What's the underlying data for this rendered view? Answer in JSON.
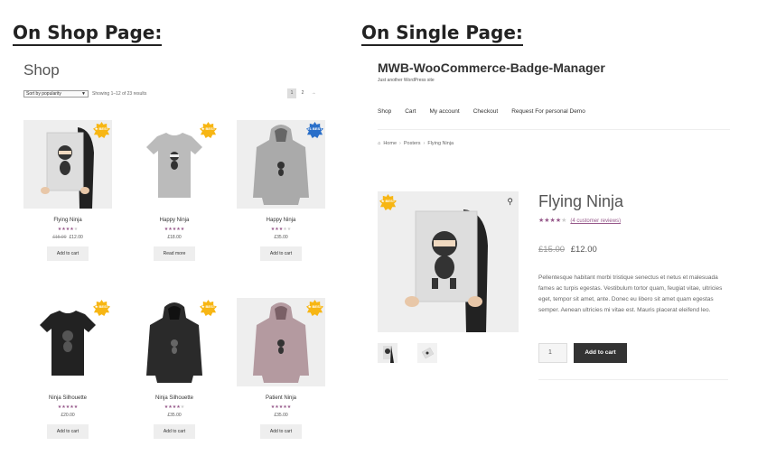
{
  "headings": {
    "shop": "On Shop Page:",
    "single": "On Single Page:"
  },
  "shop": {
    "title": "Shop",
    "sort": "Sort by popularity",
    "result_count": "Showing 1–12 of 23 results",
    "pages": [
      "1",
      "2",
      "→"
    ],
    "products": [
      {
        "name": "Flying Ninja",
        "old_price": "£15.00",
        "price": "£12.00",
        "rating": 4,
        "button": "Add to cart",
        "badge": "★ BEST",
        "badge_color": "#f7b614",
        "image": "poster"
      },
      {
        "name": "Happy Ninja",
        "old_price": "",
        "price": "£18.00",
        "rating": 5,
        "button": "Read more",
        "badge": "★ BEST",
        "badge_color": "#f7b614",
        "image": "tshirt-grey"
      },
      {
        "name": "Happy Ninja",
        "old_price": "",
        "price": "£35.00",
        "rating": 3,
        "button": "Add to cart",
        "badge": "#1 BEST",
        "badge_color": "#2a6fc9",
        "image": "hoodie-grey"
      },
      {
        "name": "Ninja Silhouette",
        "old_price": "",
        "price": "£20.00",
        "rating": 5,
        "button": "Add to cart",
        "badge": "★ BEST",
        "badge_color": "#f7b614",
        "image": "tshirt-black"
      },
      {
        "name": "Ninja Silhouette",
        "old_price": "",
        "price": "£35.00",
        "rating": 4,
        "button": "Add to cart",
        "badge": "★ BEST",
        "badge_color": "#f7b614",
        "image": "hoodie-black"
      },
      {
        "name": "Patient Ninja",
        "old_price": "",
        "price": "£35.00",
        "rating": 5,
        "button": "Add to cart",
        "badge": "★ BEST",
        "badge_color": "#f7b614",
        "image": "hoodie-pink"
      }
    ]
  },
  "single": {
    "site_title": "MWB-WooCommerce-Badge-Manager",
    "tagline": "Just another WordPress site",
    "nav": [
      "Shop",
      "Cart",
      "My account",
      "Checkout",
      "Request For personal Demo"
    ],
    "breadcrumb": {
      "home": "Home",
      "category": "Posters",
      "current": "Flying Ninja"
    },
    "product_title": "Flying Ninja",
    "rating": 4,
    "reviews": "(4 customer reviews)",
    "old_price": "£15.00",
    "price": "£12.00",
    "description": "Pellentesque habitant morbi tristique senectus et netus et malesuada fames ac turpis egestas. Vestibulum tortor quam, feugiat vitae, ultricies eget, tempor sit amet, ante. Donec eu libero sit amet quam egestas semper. Aenean ultricies mi vitae est. Mauris placerat eleifend leo.",
    "qty": "1",
    "button": "Add to cart",
    "badge": "★ BEST",
    "badge_color": "#f7b614"
  }
}
